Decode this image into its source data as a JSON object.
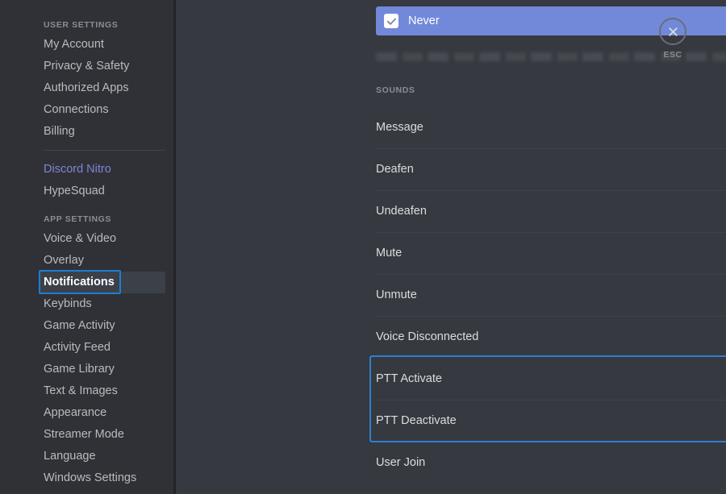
{
  "sidebar": {
    "groups": [
      {
        "heading": "USER SETTINGS",
        "items": [
          {
            "label": "My Account",
            "style": "normal",
            "selected": false
          },
          {
            "label": "Privacy & Safety",
            "style": "normal",
            "selected": false
          },
          {
            "label": "Authorized Apps",
            "style": "normal",
            "selected": false
          },
          {
            "label": "Connections",
            "style": "normal",
            "selected": false
          },
          {
            "label": "Billing",
            "style": "normal",
            "selected": false
          }
        ]
      },
      {
        "heading": "",
        "divider": true,
        "items": [
          {
            "label": "Discord Nitro",
            "style": "nitro",
            "selected": false
          },
          {
            "label": "HypeSquad",
            "style": "normal",
            "selected": false
          }
        ]
      },
      {
        "heading": "APP SETTINGS",
        "items": [
          {
            "label": "Voice & Video",
            "style": "normal",
            "selected": false
          },
          {
            "label": "Overlay",
            "style": "normal",
            "selected": false
          },
          {
            "label": "Notifications",
            "style": "normal",
            "selected": true
          },
          {
            "label": "Keybinds",
            "style": "normal",
            "selected": false
          },
          {
            "label": "Game Activity",
            "style": "normal",
            "selected": false
          },
          {
            "label": "Activity Feed",
            "style": "normal",
            "selected": false
          },
          {
            "label": "Game Library",
            "style": "normal",
            "selected": false
          },
          {
            "label": "Text & Images",
            "style": "normal",
            "selected": false
          },
          {
            "label": "Appearance",
            "style": "normal",
            "selected": false
          },
          {
            "label": "Streamer Mode",
            "style": "normal",
            "selected": false
          },
          {
            "label": "Language",
            "style": "normal",
            "selected": false
          },
          {
            "label": "Windows Settings",
            "style": "normal",
            "selected": false
          }
        ]
      }
    ]
  },
  "close": {
    "icon": "close-icon",
    "label": "ESC"
  },
  "main": {
    "selected_option": {
      "label": "Never",
      "checked": true
    },
    "sounds_heading": "SOUNDS",
    "rows": [
      {
        "label": "Message",
        "enabled": true,
        "highlighted": false
      },
      {
        "label": "Deafen",
        "enabled": true,
        "highlighted": false
      },
      {
        "label": "Undeafen",
        "enabled": true,
        "highlighted": false
      },
      {
        "label": "Mute",
        "enabled": true,
        "highlighted": false
      },
      {
        "label": "Unmute",
        "enabled": true,
        "highlighted": false
      },
      {
        "label": "Voice Disconnected",
        "enabled": true,
        "highlighted": false
      },
      {
        "label": "PTT Activate",
        "enabled": false,
        "highlighted": true
      },
      {
        "label": "PTT Deactivate",
        "enabled": false,
        "highlighted": true
      },
      {
        "label": "User Join",
        "enabled": true,
        "highlighted": false
      }
    ]
  },
  "colors": {
    "accent": "#7289da",
    "highlight_border": "#2f7fd0",
    "sidebar_selected_border": "#1b7fd6",
    "toggle_off": "#72767d",
    "sidebar_bg": "#2f3136",
    "main_bg": "#36393f"
  }
}
